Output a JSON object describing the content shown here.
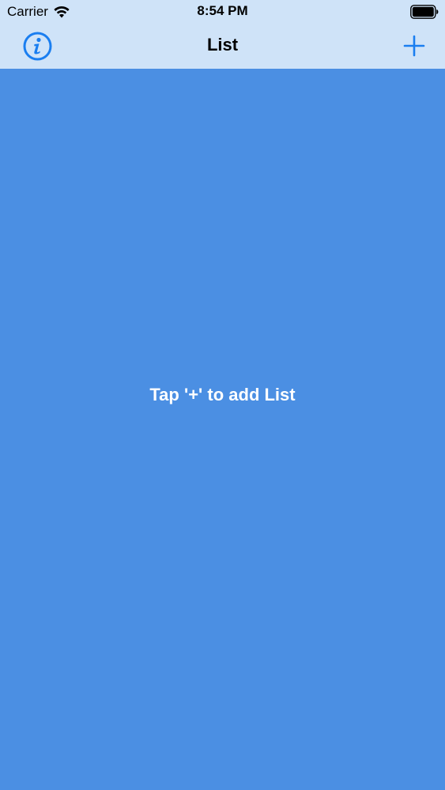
{
  "status_bar": {
    "carrier": "Carrier",
    "time": "8:54 PM",
    "icons": [
      "wifi-icon",
      "battery-icon"
    ]
  },
  "nav_bar": {
    "title": "List",
    "left_icon": "info-icon",
    "right_icon": "plus-icon"
  },
  "content": {
    "empty_message": "Tap '+' to add List"
  },
  "colors": {
    "nav_background": "#cfe3f8",
    "content_background": "#4b8fe3",
    "accent": "#1a7ef0",
    "text_on_content": "#ffffff"
  }
}
